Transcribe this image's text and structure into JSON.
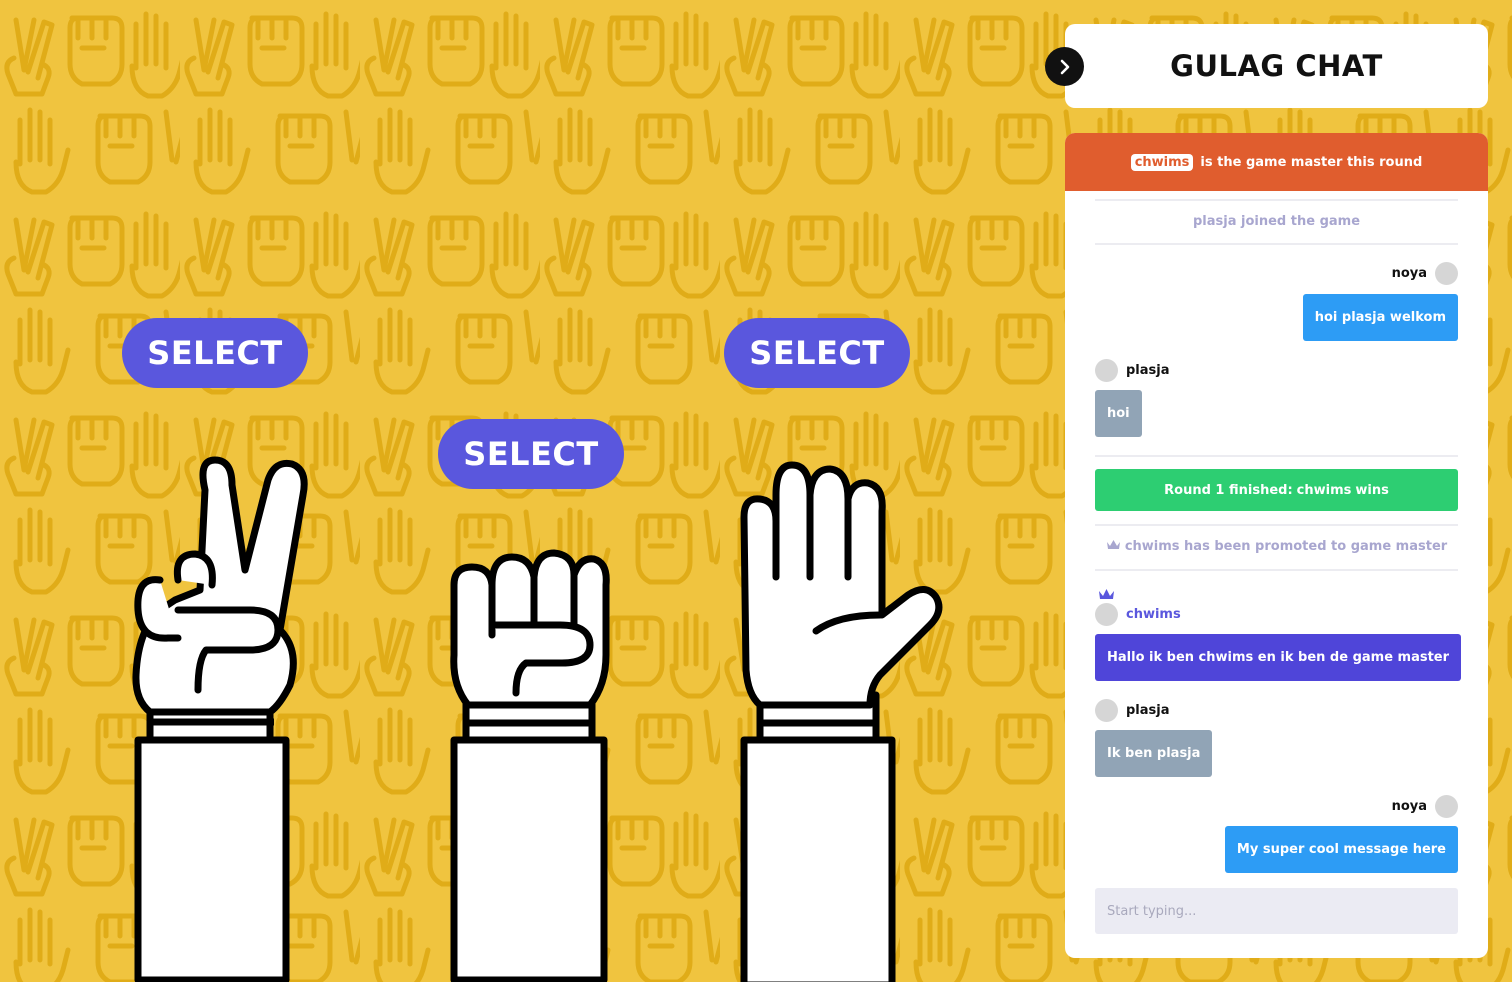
{
  "game": {
    "select_buttons": {
      "scissors": "SELECT",
      "rock": "SELECT",
      "paper": "SELECT"
    }
  },
  "chat": {
    "title": "GULAG CHAT",
    "game_master_banner": {
      "name": "chwims",
      "text": "is the game master this round"
    },
    "input_placeholder": "Start typing...",
    "messages": [
      {
        "type": "system",
        "text": "plasja joined the game"
      },
      {
        "type": "user",
        "side": "right",
        "user": "noya",
        "text": "hoi plasja welkom"
      },
      {
        "type": "user",
        "side": "left",
        "user": "plasja",
        "text": "hoi"
      },
      {
        "type": "round",
        "prefix": "Round 1 finished:",
        "winner": "chwims",
        "suffix": "wins"
      },
      {
        "type": "system",
        "text": "chwims has been promoted to game master",
        "icon": "crown-icon"
      },
      {
        "type": "user",
        "side": "left",
        "user": "chwims",
        "is_game_master": true,
        "icon": "crown-icon",
        "text": "Hallo ik ben chwims en ik ben de game master"
      },
      {
        "type": "user",
        "side": "left",
        "user": "plasja",
        "text": "Ik ben plasja"
      },
      {
        "type": "user",
        "side": "right",
        "user": "noya",
        "text": "My super cool message here"
      }
    ]
  },
  "colors": {
    "background": "#f0c43f",
    "pattern": "#e0ac18",
    "select_button": "#5a57dd",
    "banner": "#e05d2e",
    "round_win": "#2dce72",
    "own_bubble": "#2d9cf5",
    "other_bubble": "#91a4b6",
    "gm_bubble": "#4f45d9"
  }
}
